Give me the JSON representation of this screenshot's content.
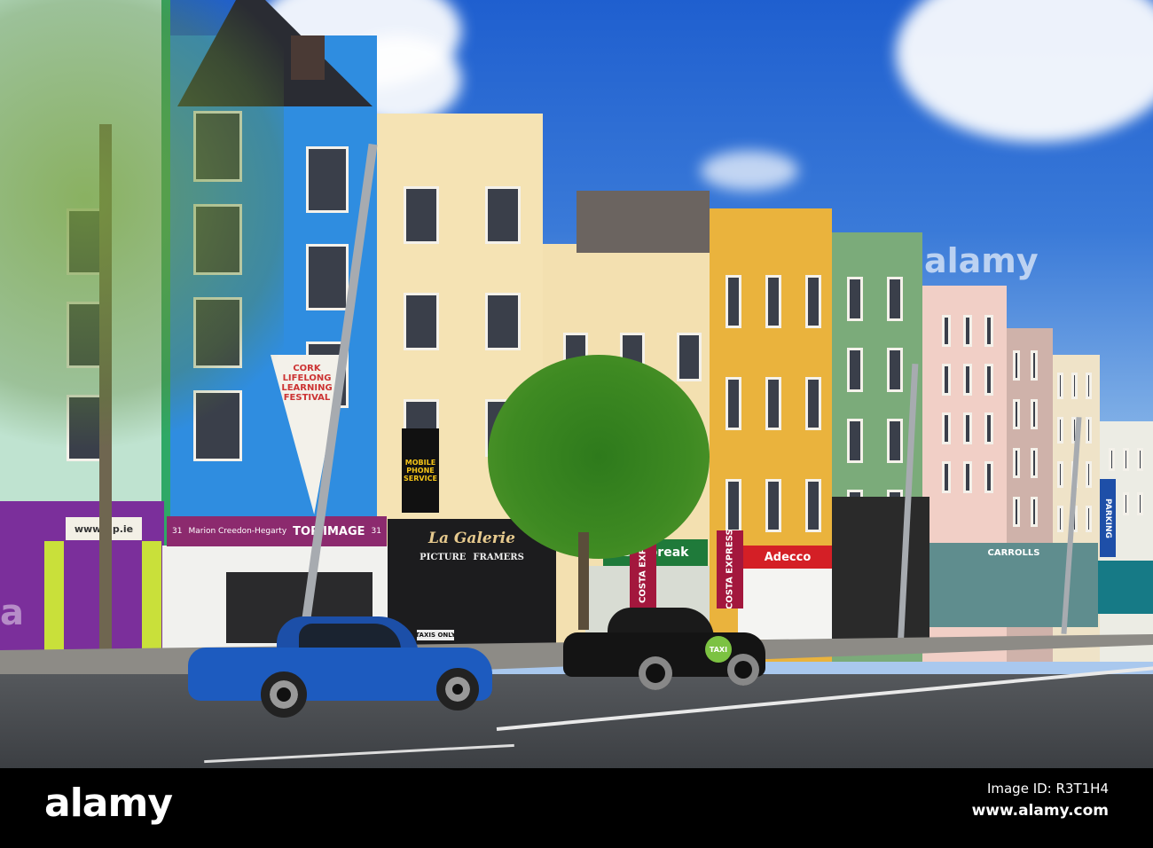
{
  "signs": {
    "top_image": "TOP IMAGE",
    "top_image_owner": "Marion Creedon-Hegarty",
    "shop_number": "31",
    "la_galerie": "La Galerie",
    "picture": "PICTURE",
    "framers": "FRAMERS",
    "daybreak": "Daybreak",
    "adecco": "Adecco",
    "costa": "COSTA EXPRESS",
    "taxi": "TAXI",
    "taxis_only": "TAXIS ONLY",
    "parking": "PARKING",
    "mobile_phone": "MOBILE PHONE SERVICE",
    "festival_banner": "CORK LIFELONG LEARNING FESTIVAL",
    "web_sign": "www.tip.ie",
    "carroll": "CARROLLS"
  },
  "watermark": {
    "logo": "alamy",
    "image_id": "Image ID: R3T1H4",
    "url": "www.alamy.com"
  },
  "colors": {
    "sky": "#2f6fd8",
    "blue_building": "#2f8de0",
    "yellow_building": "#eab33d",
    "green_building": "#7bab7a",
    "adecco_red": "#d41f26",
    "daybreak_green": "#1f7a3a",
    "top_image_purple": "#8c2a6e"
  }
}
